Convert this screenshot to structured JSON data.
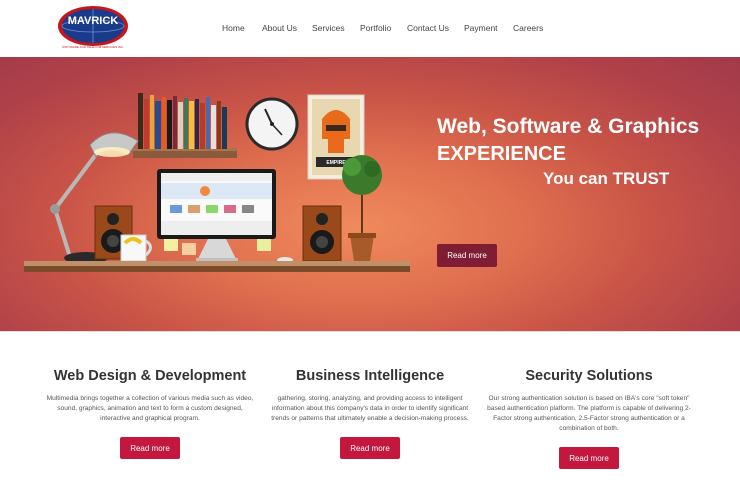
{
  "header": {
    "logo_text": "MAVRICK",
    "logo_subtext": "SOFTWARE AND TELECOM SERVICES INC.",
    "nav": [
      "Home",
      "About Us",
      "Services",
      "Portfolio",
      "Contact Us",
      "Payment",
      "Careers"
    ]
  },
  "hero": {
    "line1": "Web, Software & Graphics",
    "line2": "EXPERIENCE",
    "line3": "You can TRUST",
    "button": "Read more",
    "poster_text": "EMPIRE"
  },
  "services": [
    {
      "title": "Web Design & Development",
      "text": "Multimedia brings together a collection of various media such as video, sound, graphics, animation and text to form a custom designed, interactive and graphical program.",
      "button": "Read more"
    },
    {
      "title": "Business Intelligence",
      "text": "gathering, storing, analyzing, and providing access to intelligent information about this company's data in order to identify significant trends or patterns that ultimately enable a decision-making process.",
      "button": "Read more"
    },
    {
      "title": "Security Solutions",
      "text": "Our strong authentication solution is based on IBA's core \"soft token\" based authentication platform. The platform is capable of delivering 2-Factor strong authentication, 2.5-Factor strong authentication or a combination of both.",
      "button": "Read more"
    }
  ],
  "colors": {
    "hero_button": "#7e1d33",
    "service_button": "#c3173e",
    "logo_blue": "#1a3a8a",
    "logo_red": "#c4161c"
  }
}
